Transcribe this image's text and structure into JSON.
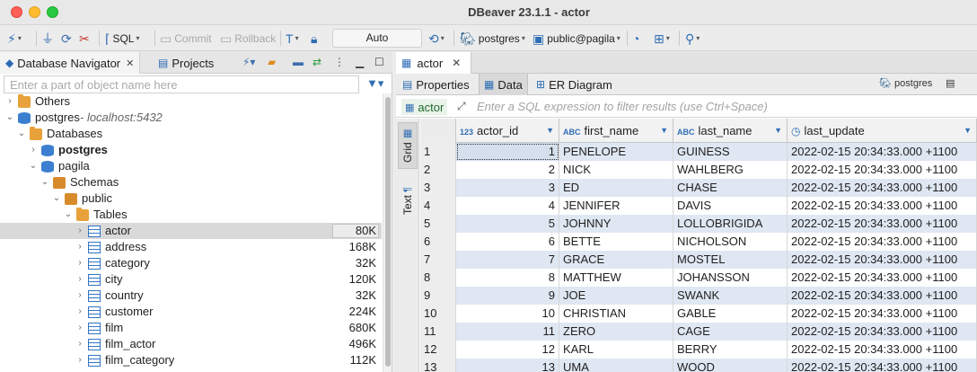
{
  "window": {
    "title": "DBeaver 23.1.1 - actor"
  },
  "toolbar": {
    "sql": "SQL",
    "commit": "Commit",
    "rollback": "Rollback",
    "auto": "Auto",
    "connection": "postgres",
    "schema": "public@pagila"
  },
  "left": {
    "tab_navigator": "Database Navigator",
    "tab_projects": "Projects",
    "filter_placeholder": "Enter a part of object name here",
    "tree": [
      {
        "label": "Others",
        "level": 0,
        "arrow": "›",
        "icon": "folder",
        "bold": false,
        "size": ""
      },
      {
        "label": "postgres",
        "suffix": " - localhost:5432",
        "level": 0,
        "arrow": "⌄",
        "icon": "db",
        "bold": false,
        "size": ""
      },
      {
        "label": "Databases",
        "level": 1,
        "arrow": "⌄",
        "icon": "folder",
        "bold": false,
        "size": ""
      },
      {
        "label": "postgres",
        "level": 2,
        "arrow": "›",
        "icon": "db",
        "bold": true,
        "size": ""
      },
      {
        "label": "pagila",
        "level": 2,
        "arrow": "⌄",
        "icon": "db",
        "bold": false,
        "size": ""
      },
      {
        "label": "Schemas",
        "level": 3,
        "arrow": "⌄",
        "icon": "schema",
        "bold": false,
        "size": ""
      },
      {
        "label": "public",
        "level": 4,
        "arrow": "⌄",
        "icon": "schema",
        "bold": false,
        "size": ""
      },
      {
        "label": "Tables",
        "level": 5,
        "arrow": "⌄",
        "icon": "folder",
        "bold": false,
        "size": ""
      },
      {
        "label": "actor",
        "level": 6,
        "arrow": "›",
        "icon": "table",
        "bold": false,
        "size": "80K",
        "selected": true
      },
      {
        "label": "address",
        "level": 6,
        "arrow": "›",
        "icon": "table",
        "bold": false,
        "size": "168K"
      },
      {
        "label": "category",
        "level": 6,
        "arrow": "›",
        "icon": "table",
        "bold": false,
        "size": "32K"
      },
      {
        "label": "city",
        "level": 6,
        "arrow": "›",
        "icon": "table",
        "bold": false,
        "size": "120K"
      },
      {
        "label": "country",
        "level": 6,
        "arrow": "›",
        "icon": "table",
        "bold": false,
        "size": "32K"
      },
      {
        "label": "customer",
        "level": 6,
        "arrow": "›",
        "icon": "table",
        "bold": false,
        "size": "224K"
      },
      {
        "label": "film",
        "level": 6,
        "arrow": "›",
        "icon": "table",
        "bold": false,
        "size": "680K"
      },
      {
        "label": "film_actor",
        "level": 6,
        "arrow": "›",
        "icon": "table",
        "bold": false,
        "size": "496K"
      },
      {
        "label": "film_category",
        "level": 6,
        "arrow": "›",
        "icon": "table",
        "bold": false,
        "size": "112K"
      }
    ]
  },
  "editor": {
    "tab_label": "actor",
    "subtabs": {
      "properties": "Properties",
      "data": "Data",
      "er": "ER Diagram"
    },
    "sub_right_conn": "postgres",
    "filter_table": "actor",
    "filter_placeholder": "Enter a SQL expression to filter results (use Ctrl+Space)",
    "side_grid": "Grid",
    "side_text": "Text"
  },
  "grid": {
    "columns": [
      {
        "name": "actor_id",
        "type": "123"
      },
      {
        "name": "first_name",
        "type": "ABC"
      },
      {
        "name": "last_name",
        "type": "ABC"
      },
      {
        "name": "last_update",
        "type": "clock"
      }
    ],
    "rows": [
      [
        "1",
        "1",
        "PENELOPE",
        "GUINESS",
        "2022-02-15 20:34:33.000 +1100"
      ],
      [
        "2",
        "2",
        "NICK",
        "WAHLBERG",
        "2022-02-15 20:34:33.000 +1100"
      ],
      [
        "3",
        "3",
        "ED",
        "CHASE",
        "2022-02-15 20:34:33.000 +1100"
      ],
      [
        "4",
        "4",
        "JENNIFER",
        "DAVIS",
        "2022-02-15 20:34:33.000 +1100"
      ],
      [
        "5",
        "5",
        "JOHNNY",
        "LOLLOBRIGIDA",
        "2022-02-15 20:34:33.000 +1100"
      ],
      [
        "6",
        "6",
        "BETTE",
        "NICHOLSON",
        "2022-02-15 20:34:33.000 +1100"
      ],
      [
        "7",
        "7",
        "GRACE",
        "MOSTEL",
        "2022-02-15 20:34:33.000 +1100"
      ],
      [
        "8",
        "8",
        "MATTHEW",
        "JOHANSSON",
        "2022-02-15 20:34:33.000 +1100"
      ],
      [
        "9",
        "9",
        "JOE",
        "SWANK",
        "2022-02-15 20:34:33.000 +1100"
      ],
      [
        "10",
        "10",
        "CHRISTIAN",
        "GABLE",
        "2022-02-15 20:34:33.000 +1100"
      ],
      [
        "11",
        "11",
        "ZERO",
        "CAGE",
        "2022-02-15 20:34:33.000 +1100"
      ],
      [
        "12",
        "12",
        "KARL",
        "BERRY",
        "2022-02-15 20:34:33.000 +1100"
      ],
      [
        "13",
        "13",
        "UMA",
        "WOOD",
        "2022-02-15 20:34:33.000 +1100"
      ]
    ]
  }
}
